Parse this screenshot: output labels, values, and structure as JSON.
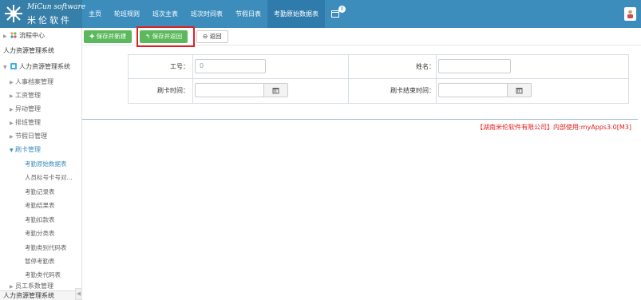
{
  "logo": {
    "en": "MiCun software",
    "cn": "米伦软件"
  },
  "topnav": [
    {
      "label": "主页"
    },
    {
      "label": "轮班规则"
    },
    {
      "label": "班次主表"
    },
    {
      "label": "班次时间表"
    },
    {
      "label": "节假日表"
    },
    {
      "label": "考勤原始数据表",
      "active": true
    }
  ],
  "more_badge": "0",
  "sidebar": {
    "top_item": "流程中心",
    "section_header": "人力资源管理系统",
    "root": "人力资源管理系统",
    "items": [
      "人事档案管理",
      "工资管理",
      "异动管理",
      "排班管理",
      "节假日管理"
    ],
    "open_group": "刷卡管理",
    "sub_items": [
      {
        "label": "考勤原始数据表",
        "active": true
      },
      {
        "label": "人员标号卡号对..."
      },
      {
        "label": "考勤记录表"
      },
      {
        "label": "考勤结果表"
      },
      {
        "label": "考勤扣款表"
      },
      {
        "label": "考勤分类表"
      },
      {
        "label": "考勤类别代码表"
      },
      {
        "label": "暂停考勤表"
      },
      {
        "label": "考勤类代码表"
      }
    ],
    "last_item": "员工系数管理",
    "footer": "人力资源管理系统"
  },
  "toolbar": {
    "save_new": "保存并新建",
    "save_return": "保存并返回",
    "back": "返回"
  },
  "form": {
    "emp_no_label": "工号：",
    "emp_no_value": "0",
    "name_label": "姓名：",
    "name_value": "",
    "card_time_label": "刷卡时间：",
    "card_time_value": "",
    "card_end_label": "刷卡结束时间：",
    "card_end_value": ""
  },
  "copyright": "【湖南米伦软件有限公司】内部使用:myApps3.0[M3]",
  "colors": {
    "header": "#3c8dbc",
    "green": "#5cb85c",
    "highlight": "#e02020"
  }
}
